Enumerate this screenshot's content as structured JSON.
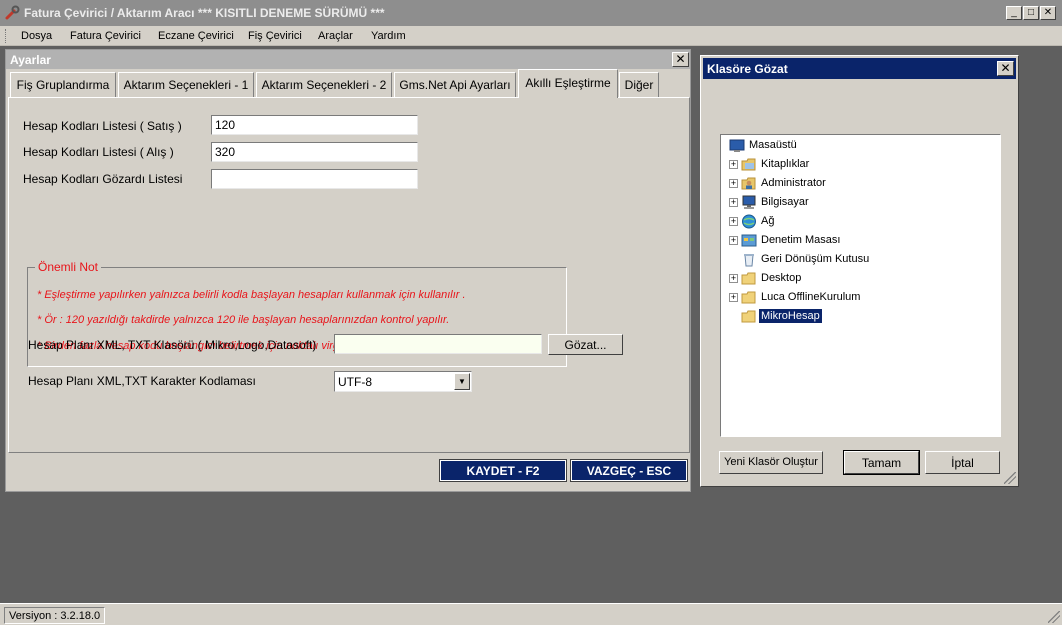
{
  "window": {
    "title": "Fatura Çevirici / Aktarım Aracı *** KISITLI DENEME SÜRÜMÜ ***",
    "minimize": "_",
    "maximize": "□",
    "close": "✕"
  },
  "menu": [
    "Dosya",
    "Fatura Çevirici",
    "Eczane Çevirici",
    "Fiş Çevirici",
    "Araçlar",
    "Yardım"
  ],
  "settings": {
    "title": "Ayarlar",
    "close": "✕",
    "tabs": [
      "Fiş Gruplandırma",
      "Aktarım Seçenekleri - 1",
      "Aktarım Seçenekleri - 2",
      "Gms.Net Api Ayarları",
      "Akıllı Eşleştirme",
      "Diğer"
    ],
    "active_tab": "Akıllı Eşleştirme",
    "fields": [
      {
        "label": "Hesap Kodları Listesi ( Satış )",
        "value": "120"
      },
      {
        "label": "Hesap Kodları Listesi ( Alış )",
        "value": "320"
      },
      {
        "label": "Hesap Kodları Gözardı Listesi",
        "value": ""
      }
    ],
    "note": {
      "title": "Önemli Not",
      "lines": [
        "* Eşleştirme yapılırken yalnızca belirli kodla başlayan hesapları kullanmak için kullanılır .",
        "* Ör : 120 yazıldığı takdirde yalnızca 120 ile başlayan hesaplarınızdan kontrol yapılır.",
        "* Birden fazla hesap kodu başlangıcı belirtmek için noktalı virgül ( ; ) ile ayırınız."
      ]
    },
    "folder_label": "Hesap Planı XML, TXT Klasörü ( Mikro,Logo,Datasoft)",
    "folder_value": "",
    "browse_button": "Gözat...",
    "encoding_label": "Hesap Planı XML,TXT Karakter Kodlaması",
    "encoding_value": "UTF-8",
    "save_button": "KAYDET - F2",
    "cancel_button": "VAZGEÇ - ESC"
  },
  "browse_dialog": {
    "title": "Klasöre Gözat",
    "close": "✕",
    "tree": [
      {
        "label": "Masaüstü",
        "icon": "desktop-icon",
        "expander": false,
        "level": 0,
        "selected": false
      },
      {
        "label": "Kitaplıklar",
        "icon": "libraries-icon",
        "expander": true,
        "level": 1,
        "selected": false
      },
      {
        "label": "Administrator",
        "icon": "user-folder-icon",
        "expander": true,
        "level": 1,
        "selected": false
      },
      {
        "label": "Bilgisayar",
        "icon": "computer-icon",
        "expander": true,
        "level": 1,
        "selected": false
      },
      {
        "label": "Ağ",
        "icon": "network-icon",
        "expander": true,
        "level": 1,
        "selected": false
      },
      {
        "label": "Denetim Masası",
        "icon": "control-panel-icon",
        "expander": true,
        "level": 1,
        "selected": false
      },
      {
        "label": "Geri Dönüşüm Kutusu",
        "icon": "recycle-bin-icon",
        "expander": false,
        "level": 1,
        "selected": false
      },
      {
        "label": "Desktop",
        "icon": "folder-icon",
        "expander": true,
        "level": 1,
        "selected": false
      },
      {
        "label": "Luca OfflineKurulum",
        "icon": "folder-icon",
        "expander": true,
        "level": 1,
        "selected": false
      },
      {
        "label": "MikroHesap",
        "icon": "folder-icon",
        "expander": false,
        "level": 1,
        "selected": true
      }
    ],
    "new_folder_button": "Yeni Klasör Oluştur",
    "ok_button": "Tamam",
    "cancel_button": "İptal"
  },
  "status": {
    "version": "Versiyon : 3.2.18.0"
  },
  "colors": {
    "active_title": "#0a246a",
    "note_red": "#e8141a",
    "face": "#d4d0c8",
    "workspace": "#5f5f5f"
  }
}
